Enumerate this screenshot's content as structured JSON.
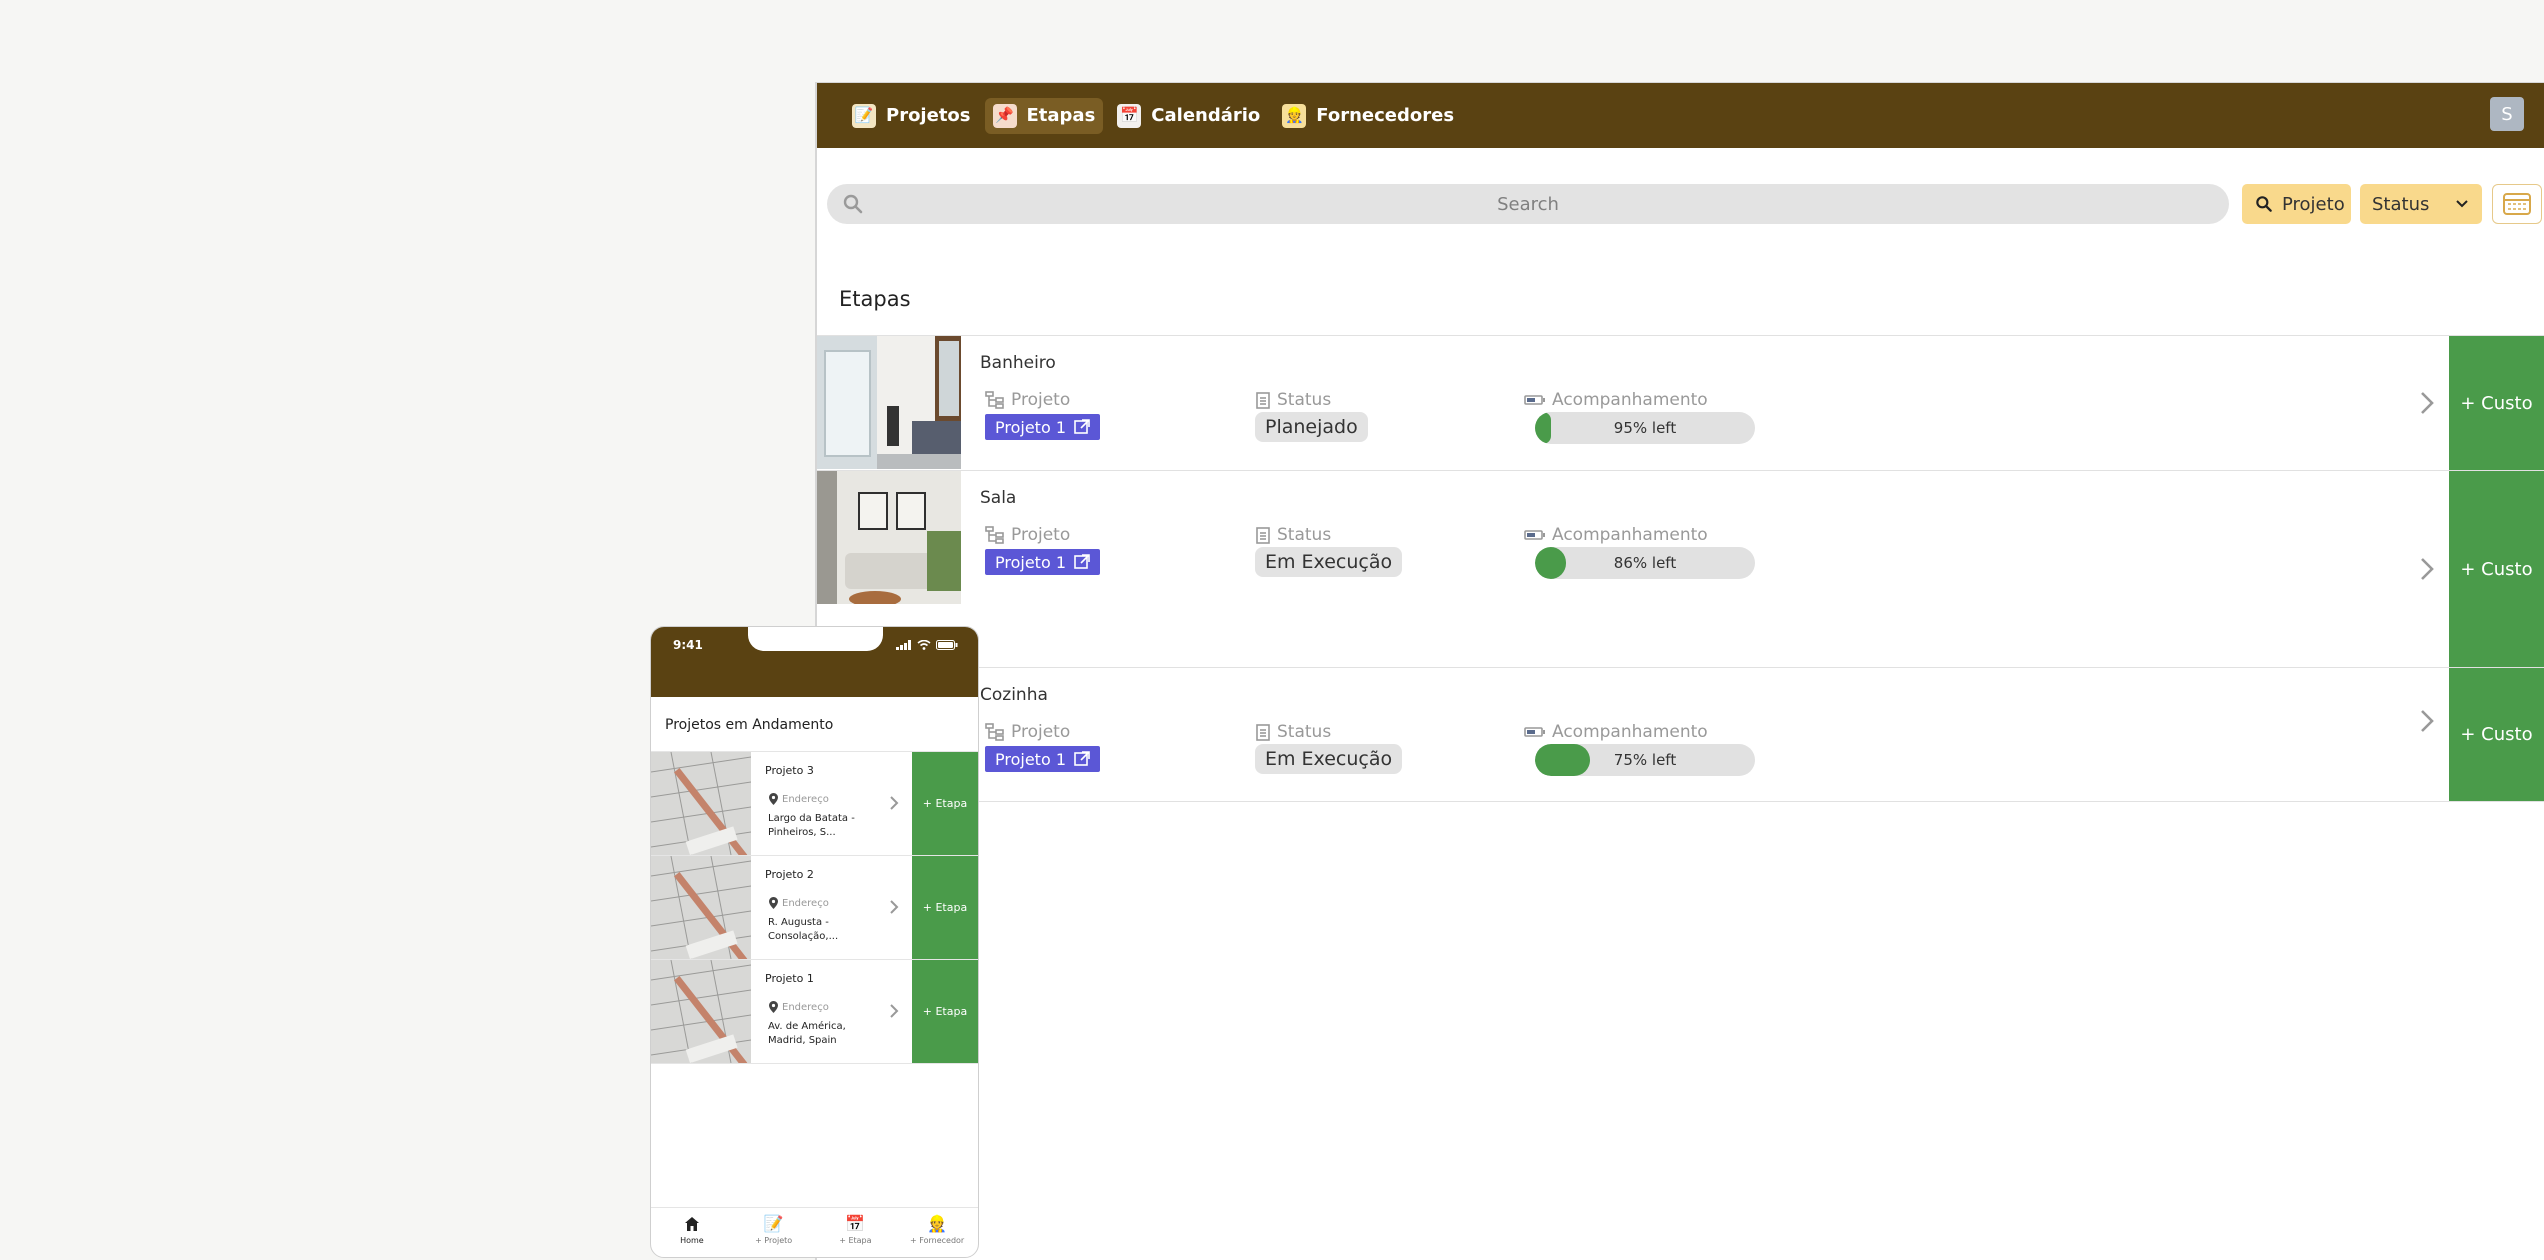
{
  "nav": {
    "items": [
      {
        "label": "Projetos",
        "icon": "memo-icon"
      },
      {
        "label": "Etapas",
        "icon": "pushpin-icon"
      },
      {
        "label": "Calendário",
        "icon": "calendar-icon"
      },
      {
        "label": "Fornecedores",
        "icon": "worker-icon"
      }
    ],
    "active": "Etapas",
    "avatar_initial": "S"
  },
  "toolbar": {
    "search_placeholder": "Search",
    "projeto_filter": "Projeto",
    "status_filter": "Status"
  },
  "section_title": "Etapas",
  "field_labels": {
    "projeto": "Projeto",
    "status": "Status",
    "acompanhamento": "Acompanhamento"
  },
  "etapas": [
    {
      "name": "Banheiro",
      "project": "Projeto 1",
      "status": "Planejado",
      "progress_fraction": 0.05,
      "progress_text": "95% left",
      "action": "+ Custo"
    },
    {
      "name": "Sala",
      "project": "Projeto 1",
      "status": "Em Execução",
      "progress_fraction": 0.14,
      "progress_text": "86% left",
      "action": "+ Custo"
    },
    {
      "name": "Cozinha",
      "project": "Projeto 1",
      "status": "Em Execução",
      "progress_fraction": 0.25,
      "progress_text": "75% left",
      "action": "+ Custo"
    }
  ],
  "colors": {
    "header": "#5a4212",
    "accent_green": "#4a9b4a",
    "project_tag": "#5b57d6",
    "filter_pill": "#f9d98c"
  },
  "mobile": {
    "time": "9:41",
    "title": "Projetos em Andamento",
    "address_label": "Endereço",
    "projects": [
      {
        "name": "Projeto 3",
        "address": "Largo da Batata - Pinheiros, S...",
        "action": "+ Etapa"
      },
      {
        "name": "Projeto 2",
        "address": "R. Augusta - Consolação,...",
        "action": "+ Etapa"
      },
      {
        "name": "Projeto 1",
        "address": "Av. de América, Madrid, Spain",
        "action": "+ Etapa"
      }
    ],
    "tabs": [
      {
        "label": "Home",
        "icon": "home-icon"
      },
      {
        "label": "+ Projeto",
        "icon": "memo-icon"
      },
      {
        "label": "+ Etapa",
        "icon": "calendar-icon"
      },
      {
        "label": "+ Fornecedor",
        "icon": "worker-icon"
      }
    ]
  }
}
